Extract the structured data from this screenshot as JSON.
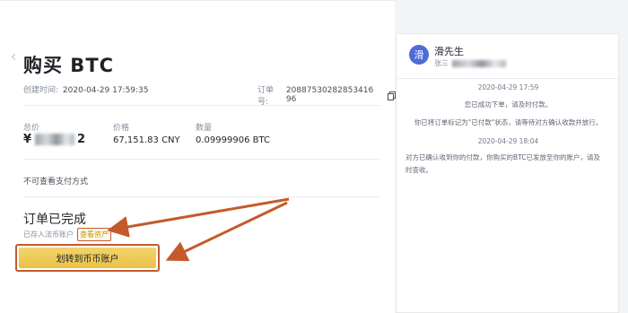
{
  "order": {
    "title": "购买 BTC",
    "created_label": "创建时间:",
    "created_value": "2020-04-29 17:59:35",
    "order_no_label": "订单号:",
    "order_no_value": "20887530282853416​96",
    "total_label": "总价",
    "total_prefix": "¥",
    "total_suffix": "2",
    "price_label": "价格",
    "price_value": "67,151.83 CNY",
    "qty_label": "数量",
    "qty_value": "0.09999906 BTC",
    "payment_note": "不可查看支付方式",
    "status_title": "订单已完成",
    "status_sub": "已存入法币账户",
    "view_assets": "查看资产",
    "transfer_button": "划转到币币账户"
  },
  "chat": {
    "avatar_char": "滑",
    "name": "滑先生",
    "sub_prefix": "张三",
    "messages": [
      {
        "text": "2020-04-29 17:59"
      },
      {
        "text": "您已成功下单，请及时付款。"
      },
      {
        "text": "你已将订单标记为\"已付款\"状态，请等待对方确认收款并放行。"
      },
      {
        "text": "2020-04-29 18:04"
      },
      {
        "text": "对方已确认收到你的付款，你购买的BTC已发放至你的账户，请及时查收。"
      }
    ]
  },
  "colors": {
    "accent_gold": "#f0cf5e",
    "annotation_orange": "#c45a2a",
    "avatar_blue": "#4f6bd8"
  },
  "icons": {
    "copy": "copy-icon",
    "back": "back-chevron-icon"
  }
}
